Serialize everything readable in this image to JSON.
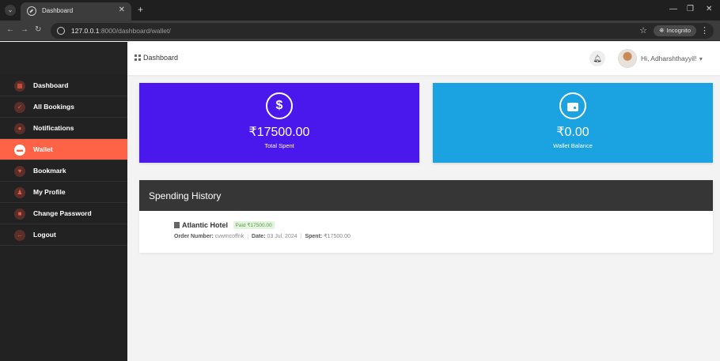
{
  "browser": {
    "tab_title": "Dashboard",
    "url_host": "127.0.0.1",
    "url_rest": ":8000/dashboard/wallet/",
    "incognito_label": "Incognito"
  },
  "sidebar": {
    "items": [
      {
        "label": "Dashboard",
        "icon": "dashboard-icon"
      },
      {
        "label": "All Bookings",
        "icon": "check-icon"
      },
      {
        "label": "Notifications",
        "icon": "bell-icon"
      },
      {
        "label": "Wallet",
        "icon": "wallet-icon",
        "active": true
      },
      {
        "label": "Bookmark",
        "icon": "heart-icon"
      },
      {
        "label": "My Profile",
        "icon": "user-icon"
      },
      {
        "label": "Change Password",
        "icon": "lock-icon"
      },
      {
        "label": "Logout",
        "icon": "arrow-left-icon"
      }
    ],
    "accent": "#ff6347"
  },
  "header": {
    "brand": "Dashboard",
    "greeting": "Hi, Adharshthayyil!"
  },
  "stats": {
    "spent": {
      "value": "₹17500.00",
      "label": "Total Spent",
      "icon": "dollar-icon",
      "color": "#4a18ed"
    },
    "balance": {
      "value": "₹0.00",
      "label": "Wallet Balance",
      "icon": "wallet-icon",
      "color": "#1aa3e0"
    }
  },
  "history": {
    "title": "Spending History",
    "entries": [
      {
        "hotel": "Atlantic Hotel",
        "badge": "Paid ₹17500.00",
        "order_label": "Order Number:",
        "order_value": "cvwmcoffnk",
        "date_label": "Date:",
        "date_value": "03 Jul, 2024",
        "spent_label": "Spent:",
        "spent_value": "₹17500.00"
      }
    ]
  }
}
